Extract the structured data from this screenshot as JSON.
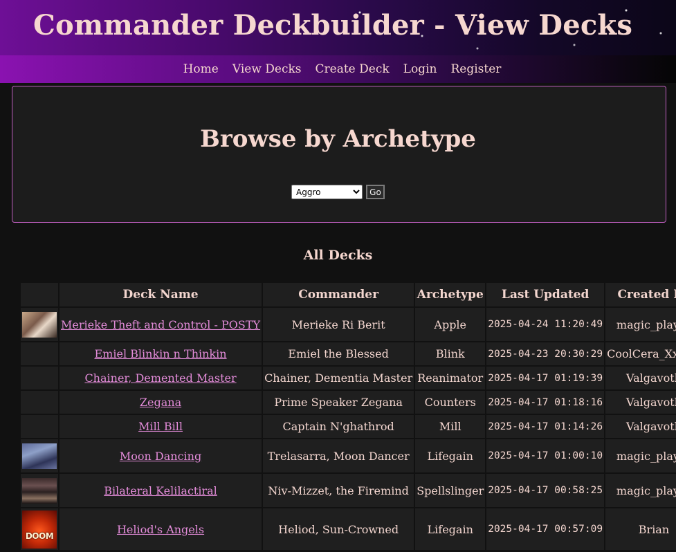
{
  "header": {
    "title": "Commander Deckbuilder - View Decks"
  },
  "nav": {
    "items": [
      "Home",
      "View Decks",
      "Create Deck",
      "Login",
      "Register"
    ]
  },
  "browse": {
    "title": "Browse by Archetype",
    "select_value": "Aggro",
    "go_label": "Go"
  },
  "decks": {
    "title": "All Decks",
    "columns": [
      "",
      "Deck Name",
      "Commander",
      "Archetype",
      "Last Updated",
      "Created By"
    ],
    "rows": [
      {
        "thumb": "photo-thumbnail",
        "name": "Merieke Theft and Control - POSTY",
        "commander": "Merieke Ri Berit",
        "archetype": "Apple",
        "updated": "2025-04-24 11:20:49",
        "creator": "magic_player"
      },
      {
        "thumb": "",
        "name": "Emiel Blinkin n Thinkin",
        "commander": "Emiel the Blessed",
        "archetype": "Blink",
        "updated": "2025-04-23 20:30:29",
        "creator": "CoolCera_XxXxX"
      },
      {
        "thumb": "",
        "name": "Chainer, Demented Master",
        "commander": "Chainer, Dementia Master",
        "archetype": "Reanimator",
        "updated": "2025-04-17 01:19:39",
        "creator": "Valgavoth"
      },
      {
        "thumb": "",
        "name": "Zegana",
        "commander": "Prime Speaker Zegana",
        "archetype": "Counters",
        "updated": "2025-04-17 01:18:16",
        "creator": "Valgavoth"
      },
      {
        "thumb": "",
        "name": "Mill Bill",
        "commander": "Captain N'ghathrod",
        "archetype": "Mill",
        "updated": "2025-04-17 01:14:26",
        "creator": "Valgavoth"
      },
      {
        "thumb": "art-thumbnail",
        "name": "Moon Dancing",
        "commander": "Trelasarra, Moon Dancer",
        "archetype": "Lifegain",
        "updated": "2025-04-17 01:00:10",
        "creator": "magic_player"
      },
      {
        "thumb": "photo-thumbnail",
        "name": "Bilateral Kelilactiral",
        "commander": "Niv-Mizzet, the Firemind",
        "archetype": "Spellslinger",
        "updated": "2025-04-17 00:58:25",
        "creator": "magic_player"
      },
      {
        "thumb": "poster-thumbnail",
        "thumb_text": "DOOM",
        "name": "Heliod's Angels",
        "commander": "Heliod, Sun-Crowned",
        "archetype": "Lifegain",
        "updated": "2025-04-17 00:57:09",
        "creator": "Brian"
      }
    ]
  }
}
